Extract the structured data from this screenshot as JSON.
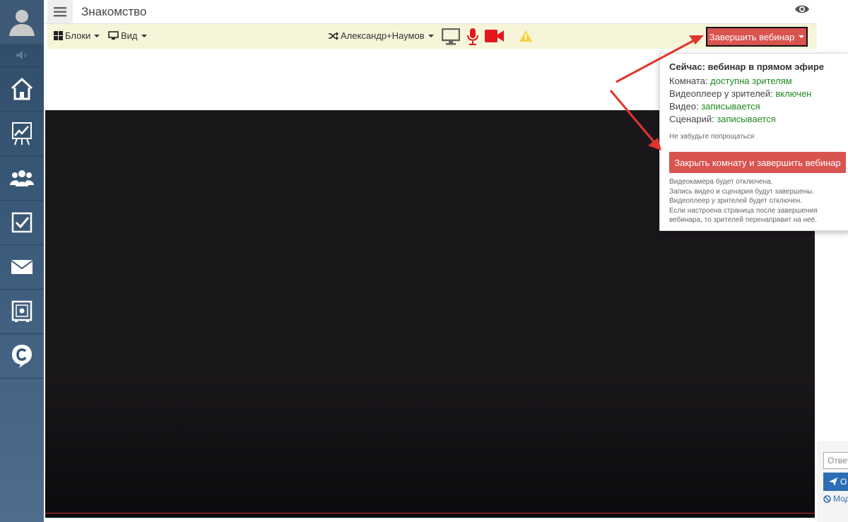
{
  "header": {
    "title": "Знакомство"
  },
  "toolbar": {
    "blocks_label": "Блоки",
    "view_label": "Вид",
    "presenter_label": "Александр+Наумов",
    "end_button_label": "Завершить вебинар"
  },
  "dropdown": {
    "status_title": "Сейчас: вебинар в прямом эфире",
    "rows": [
      {
        "label": "Комната: ",
        "value": "доступна зрителям"
      },
      {
        "label": "Видеоплеер у зрителей: ",
        "value": "включен"
      },
      {
        "label": "Видео: ",
        "value": "записывается"
      },
      {
        "label": "Сценарий: ",
        "value": "записывается"
      }
    ],
    "note": "Не забудьте попрощаться",
    "close_button_label": "Закрыть комнату и завершить вебинар",
    "info_lines": [
      "Видеокамера будет отключена.",
      "Запись видео и сценария будут завершены.",
      "Видеоплеер у зрителей будет отключен.",
      "Если настроена страница после завершения",
      "вебинара, то зрителей перенаправит на неё."
    ]
  },
  "chat": {
    "input_placeholder": "Ответ",
    "send_label": "О",
    "moderation_label": "Мод"
  },
  "colors": {
    "sidebar": "#3a5878",
    "toolbar_bg": "#f6f5da",
    "danger": "#d9534f",
    "status_green": "#1e8a1e",
    "video_bg": "#1a171b",
    "mic_red": "#e5161b"
  },
  "icons": {
    "sidebar": [
      "user-avatar-icon",
      "speaker-icon",
      "home-icon",
      "chart-board-icon",
      "users-group-icon",
      "checkbox-icon",
      "mail-icon",
      "safe-icon",
      "brand-c-icon"
    ],
    "toolbar": [
      "grid-icon",
      "monitor-icon",
      "shuffle-icon",
      "screen-share-icon",
      "microphone-icon",
      "camera-icon",
      "warning-icon"
    ]
  }
}
